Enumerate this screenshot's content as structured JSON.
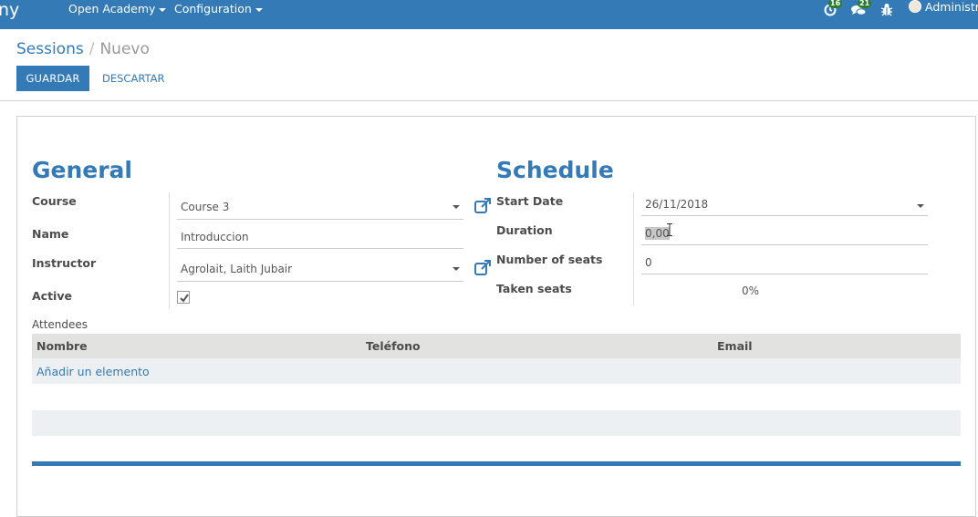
{
  "navbar": {
    "brand": "ny",
    "menus": [
      {
        "label": "Open Academy"
      },
      {
        "label": "Configuration"
      }
    ],
    "activities_badge": "16",
    "messages_badge": "21",
    "user_label": "Administra"
  },
  "breadcrumb": {
    "parent": "Sessions",
    "separator": "/",
    "current": "Nuevo"
  },
  "buttons": {
    "save": "GUARDAR",
    "discard": "DESCARTAR"
  },
  "general": {
    "title": "General",
    "course_label": "Course",
    "course_value": "Course 3",
    "name_label": "Name",
    "name_value": "Introduccion",
    "instructor_label": "Instructor",
    "instructor_value": "Agrolait, Laith Jubair",
    "active_label": "Active",
    "active_checked": true
  },
  "schedule": {
    "title": "Schedule",
    "start_date_label": "Start Date",
    "start_date_value": "26/11/2018",
    "duration_label": "Duration",
    "duration_value": "0,00",
    "seats_label": "Number of seats",
    "seats_value": "0",
    "taken_seats_label": "Taken seats",
    "taken_seats_value": "0%"
  },
  "attendees": {
    "label": "Attendees",
    "columns": [
      "Nombre",
      "Teléfono",
      "Email"
    ],
    "add_line": "Añadir un elemento"
  },
  "colors": {
    "primary": "#337ab7",
    "header_bg": "#e2e2e0",
    "stripe_bg": "#edf0f2"
  }
}
